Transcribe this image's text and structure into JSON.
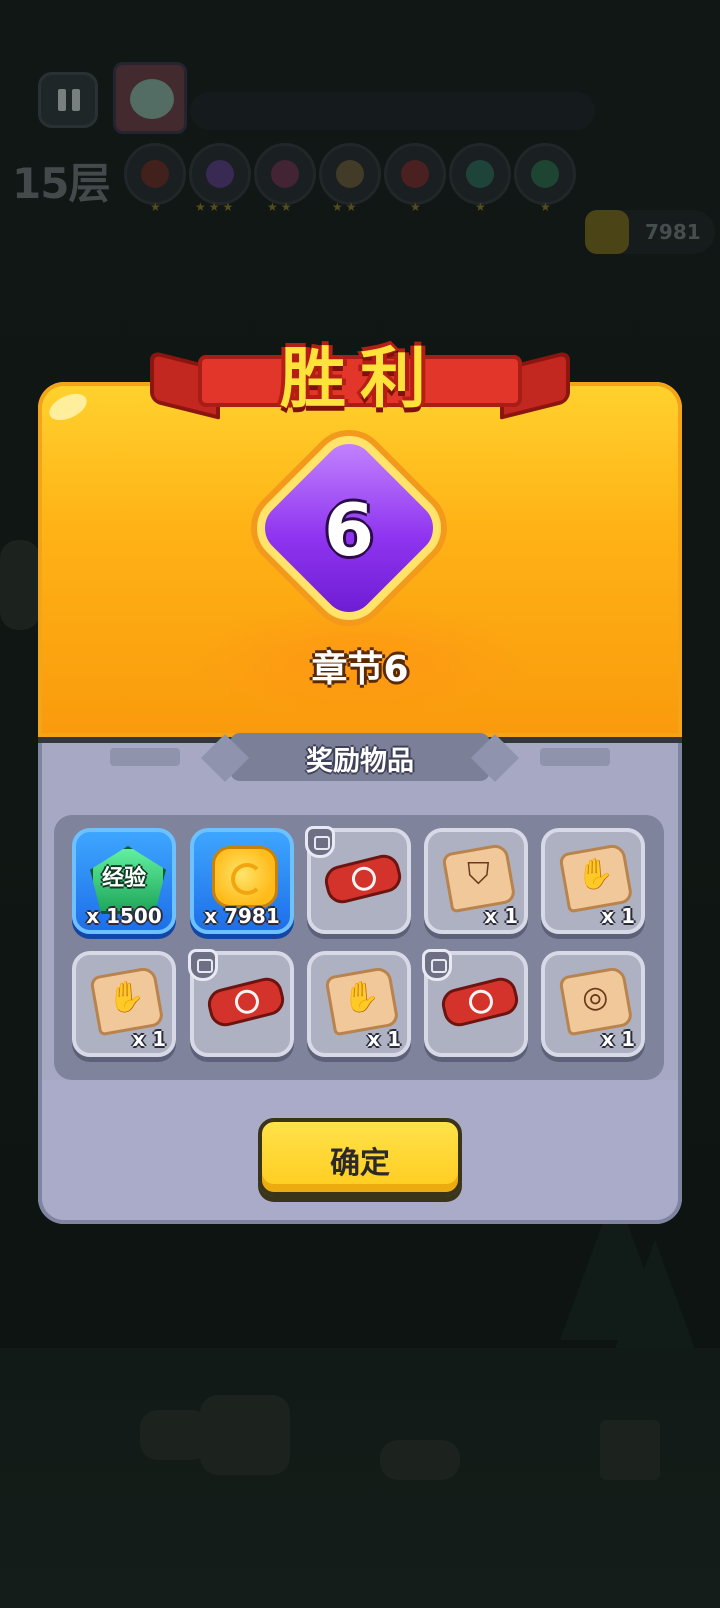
{
  "hud": {
    "floor": "15层",
    "coins": "7981",
    "skills": [
      "skill-target",
      "skill-eraser",
      "skill-rocket",
      "skill-cane",
      "skill-bomb",
      "skill-arrow-up",
      "skill-hexagram"
    ],
    "skill_stars": [
      "★",
      "★★★",
      "★★",
      "★★",
      "★",
      "★",
      "★"
    ]
  },
  "dialog": {
    "title": "胜利",
    "chapter_number": "6",
    "chapter_label": "章节6",
    "rewards_title": "奖励物品",
    "confirm_label": "确定"
  },
  "rewards": [
    {
      "icon": "exp-gem-icon",
      "label": "经验",
      "qty": "x 1500",
      "style": "blue"
    },
    {
      "icon": "gold-coin-icon",
      "qty": "x 7981",
      "style": "blue"
    },
    {
      "icon": "red-belt-icon",
      "qty": "",
      "badge": "shield"
    },
    {
      "icon": "armor-fragment-icon",
      "qty": "x 1"
    },
    {
      "icon": "glove-fragment-icon",
      "qty": "x 1"
    },
    {
      "icon": "glove-fragment-icon",
      "qty": "x 1"
    },
    {
      "icon": "red-belt-icon",
      "qty": "",
      "badge": "shield"
    },
    {
      "icon": "glove-fragment-icon",
      "qty": "x 1"
    },
    {
      "icon": "red-belt-icon",
      "qty": "",
      "badge": "shield"
    },
    {
      "icon": "ring-fragment-icon",
      "qty": "x 1"
    }
  ],
  "colors": {
    "victory_gold": "#ffe23a",
    "banner_red": "#e2362a",
    "gem_purple": "#8f34f0",
    "panel_gray": "#a7a9c4",
    "button_yellow": "#ffd83a",
    "slot_blue": "#2b8bff"
  }
}
